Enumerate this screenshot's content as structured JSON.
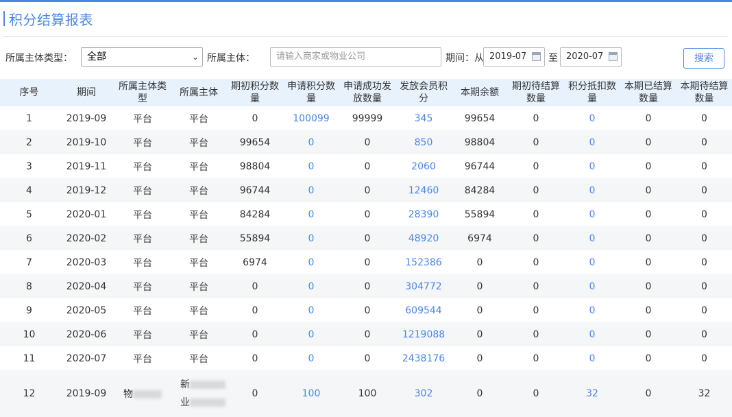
{
  "header": {
    "title": "积分结算报表"
  },
  "filters": {
    "entity_type_label": "所属主体类型：",
    "entity_type_value": "全部",
    "entity_label": "所属主体：",
    "entity_placeholder": "请输入商家或物业公司",
    "period_label": "期间：从",
    "period_from": "2019-07",
    "to_label": "至",
    "period_to": "2020-07",
    "search_label": "搜索"
  },
  "table": {
    "headers": [
      "序号",
      "期间",
      "所属主体类型",
      "所属主体",
      "期初积分数量",
      "申请积分数量",
      "申请成功发放数量",
      "发放会员积分",
      "本期余额",
      "期初待结算数量",
      "积分抵扣数量",
      "本期已结算数量",
      "本期待结算数量"
    ],
    "rows": [
      [
        "1",
        "2019-09",
        "平台",
        "平台",
        "0",
        "100099",
        "99999",
        "345",
        "99654",
        "0",
        "0",
        "0",
        "0"
      ],
      [
        "2",
        "2019-10",
        "平台",
        "平台",
        "99654",
        "0",
        "0",
        "850",
        "98804",
        "0",
        "0",
        "0",
        "0"
      ],
      [
        "3",
        "2019-11",
        "平台",
        "平台",
        "98804",
        "0",
        "0",
        "2060",
        "96744",
        "0",
        "0",
        "0",
        "0"
      ],
      [
        "4",
        "2019-12",
        "平台",
        "平台",
        "96744",
        "0",
        "0",
        "12460",
        "84284",
        "0",
        "0",
        "0",
        "0"
      ],
      [
        "5",
        "2020-01",
        "平台",
        "平台",
        "84284",
        "0",
        "0",
        "28390",
        "55894",
        "0",
        "0",
        "0",
        "0"
      ],
      [
        "6",
        "2020-02",
        "平台",
        "平台",
        "55894",
        "0",
        "0",
        "48920",
        "6974",
        "0",
        "0",
        "0",
        "0"
      ],
      [
        "7",
        "2020-03",
        "平台",
        "平台",
        "6974",
        "0",
        "0",
        "152386",
        "0",
        "0",
        "0",
        "0",
        "0"
      ],
      [
        "8",
        "2020-04",
        "平台",
        "平台",
        "0",
        "0",
        "0",
        "304772",
        "0",
        "0",
        "0",
        "0",
        "0"
      ],
      [
        "9",
        "2020-05",
        "平台",
        "平台",
        "0",
        "0",
        "0",
        "609544",
        "0",
        "0",
        "0",
        "0",
        "0"
      ],
      [
        "10",
        "2020-06",
        "平台",
        "平台",
        "0",
        "0",
        "0",
        "1219088",
        "0",
        "0",
        "0",
        "0",
        "0"
      ],
      [
        "11",
        "2020-07",
        "平台",
        "平台",
        "0",
        "0",
        "0",
        "2438176",
        "0",
        "0",
        "0",
        "0",
        "0"
      ],
      [
        "12",
        "2019-09",
        "物业",
        "新 业",
        "0",
        "100",
        "100",
        "302",
        "0",
        "0",
        "32",
        "0",
        "32"
      ]
    ],
    "row12_type_visible": "物",
    "row12_entity_line1": "新",
    "row12_entity_line2": "业"
  },
  "colors": {
    "accent": "#4a86e8",
    "header_bg": "#e8f2fd",
    "alt_row": "#f5f6f8"
  }
}
